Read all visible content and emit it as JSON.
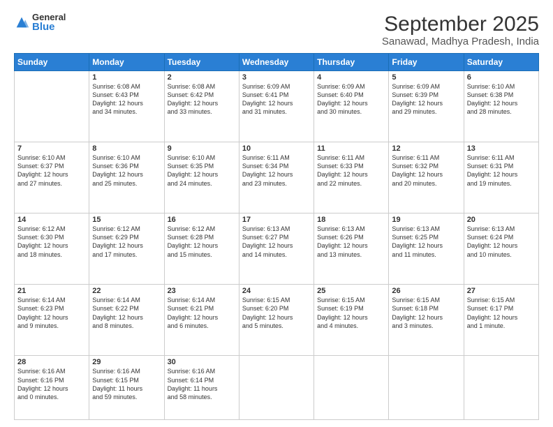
{
  "logo": {
    "general": "General",
    "blue": "Blue"
  },
  "title": "September 2025",
  "subtitle": "Sanawad, Madhya Pradesh, India",
  "weekdays": [
    "Sunday",
    "Monday",
    "Tuesday",
    "Wednesday",
    "Thursday",
    "Friday",
    "Saturday"
  ],
  "weeks": [
    [
      {
        "day": "",
        "info": ""
      },
      {
        "day": "1",
        "info": "Sunrise: 6:08 AM\nSunset: 6:43 PM\nDaylight: 12 hours\nand 34 minutes."
      },
      {
        "day": "2",
        "info": "Sunrise: 6:08 AM\nSunset: 6:42 PM\nDaylight: 12 hours\nand 33 minutes."
      },
      {
        "day": "3",
        "info": "Sunrise: 6:09 AM\nSunset: 6:41 PM\nDaylight: 12 hours\nand 31 minutes."
      },
      {
        "day": "4",
        "info": "Sunrise: 6:09 AM\nSunset: 6:40 PM\nDaylight: 12 hours\nand 30 minutes."
      },
      {
        "day": "5",
        "info": "Sunrise: 6:09 AM\nSunset: 6:39 PM\nDaylight: 12 hours\nand 29 minutes."
      },
      {
        "day": "6",
        "info": "Sunrise: 6:10 AM\nSunset: 6:38 PM\nDaylight: 12 hours\nand 28 minutes."
      }
    ],
    [
      {
        "day": "7",
        "info": "Sunrise: 6:10 AM\nSunset: 6:37 PM\nDaylight: 12 hours\nand 27 minutes."
      },
      {
        "day": "8",
        "info": "Sunrise: 6:10 AM\nSunset: 6:36 PM\nDaylight: 12 hours\nand 25 minutes."
      },
      {
        "day": "9",
        "info": "Sunrise: 6:10 AM\nSunset: 6:35 PM\nDaylight: 12 hours\nand 24 minutes."
      },
      {
        "day": "10",
        "info": "Sunrise: 6:11 AM\nSunset: 6:34 PM\nDaylight: 12 hours\nand 23 minutes."
      },
      {
        "day": "11",
        "info": "Sunrise: 6:11 AM\nSunset: 6:33 PM\nDaylight: 12 hours\nand 22 minutes."
      },
      {
        "day": "12",
        "info": "Sunrise: 6:11 AM\nSunset: 6:32 PM\nDaylight: 12 hours\nand 20 minutes."
      },
      {
        "day": "13",
        "info": "Sunrise: 6:11 AM\nSunset: 6:31 PM\nDaylight: 12 hours\nand 19 minutes."
      }
    ],
    [
      {
        "day": "14",
        "info": "Sunrise: 6:12 AM\nSunset: 6:30 PM\nDaylight: 12 hours\nand 18 minutes."
      },
      {
        "day": "15",
        "info": "Sunrise: 6:12 AM\nSunset: 6:29 PM\nDaylight: 12 hours\nand 17 minutes."
      },
      {
        "day": "16",
        "info": "Sunrise: 6:12 AM\nSunset: 6:28 PM\nDaylight: 12 hours\nand 15 minutes."
      },
      {
        "day": "17",
        "info": "Sunrise: 6:13 AM\nSunset: 6:27 PM\nDaylight: 12 hours\nand 14 minutes."
      },
      {
        "day": "18",
        "info": "Sunrise: 6:13 AM\nSunset: 6:26 PM\nDaylight: 12 hours\nand 13 minutes."
      },
      {
        "day": "19",
        "info": "Sunrise: 6:13 AM\nSunset: 6:25 PM\nDaylight: 12 hours\nand 11 minutes."
      },
      {
        "day": "20",
        "info": "Sunrise: 6:13 AM\nSunset: 6:24 PM\nDaylight: 12 hours\nand 10 minutes."
      }
    ],
    [
      {
        "day": "21",
        "info": "Sunrise: 6:14 AM\nSunset: 6:23 PM\nDaylight: 12 hours\nand 9 minutes."
      },
      {
        "day": "22",
        "info": "Sunrise: 6:14 AM\nSunset: 6:22 PM\nDaylight: 12 hours\nand 8 minutes."
      },
      {
        "day": "23",
        "info": "Sunrise: 6:14 AM\nSunset: 6:21 PM\nDaylight: 12 hours\nand 6 minutes."
      },
      {
        "day": "24",
        "info": "Sunrise: 6:15 AM\nSunset: 6:20 PM\nDaylight: 12 hours\nand 5 minutes."
      },
      {
        "day": "25",
        "info": "Sunrise: 6:15 AM\nSunset: 6:19 PM\nDaylight: 12 hours\nand 4 minutes."
      },
      {
        "day": "26",
        "info": "Sunrise: 6:15 AM\nSunset: 6:18 PM\nDaylight: 12 hours\nand 3 minutes."
      },
      {
        "day": "27",
        "info": "Sunrise: 6:15 AM\nSunset: 6:17 PM\nDaylight: 12 hours\nand 1 minute."
      }
    ],
    [
      {
        "day": "28",
        "info": "Sunrise: 6:16 AM\nSunset: 6:16 PM\nDaylight: 12 hours\nand 0 minutes."
      },
      {
        "day": "29",
        "info": "Sunrise: 6:16 AM\nSunset: 6:15 PM\nDaylight: 11 hours\nand 59 minutes."
      },
      {
        "day": "30",
        "info": "Sunrise: 6:16 AM\nSunset: 6:14 PM\nDaylight: 11 hours\nand 58 minutes."
      },
      {
        "day": "",
        "info": ""
      },
      {
        "day": "",
        "info": ""
      },
      {
        "day": "",
        "info": ""
      },
      {
        "day": "",
        "info": ""
      }
    ]
  ]
}
